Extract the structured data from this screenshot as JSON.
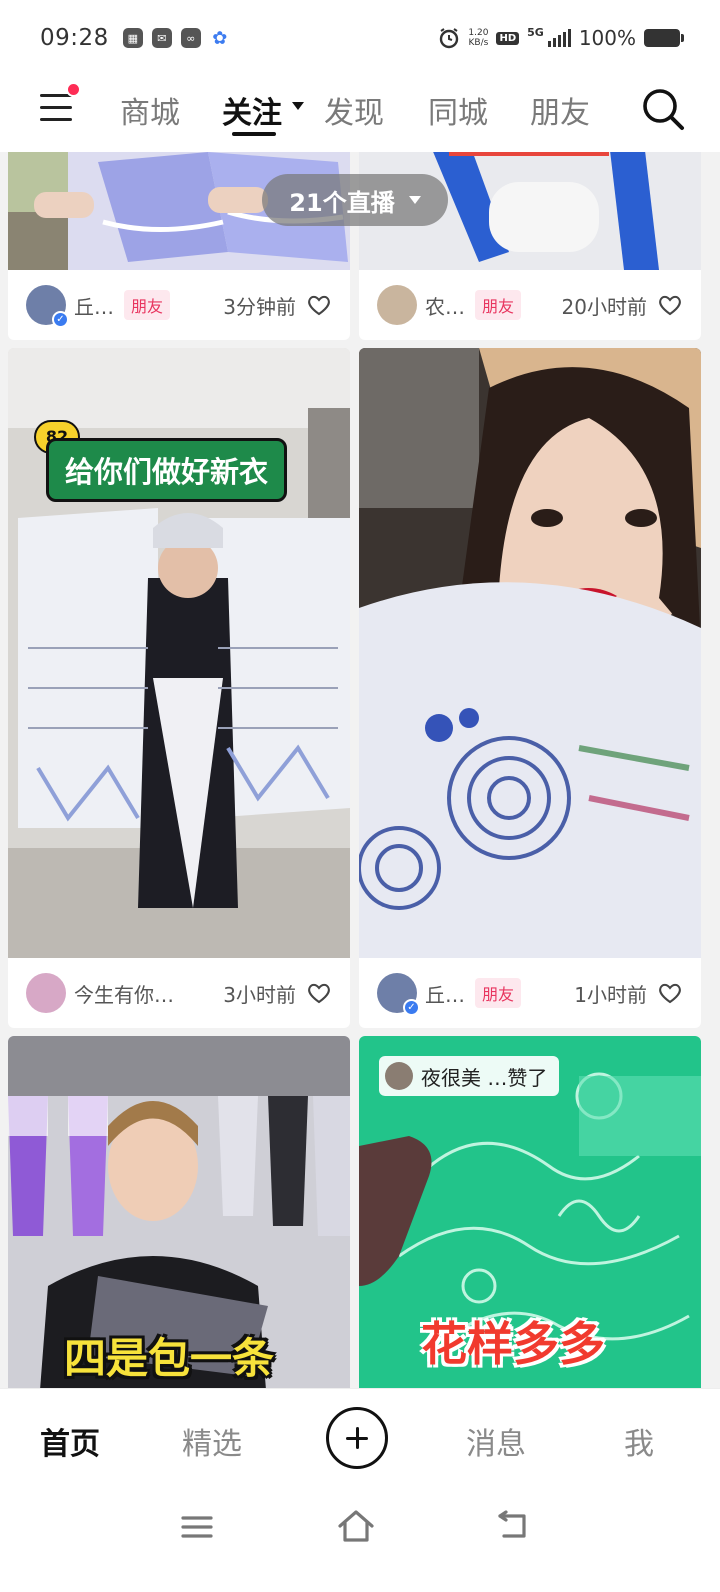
{
  "status_bar": {
    "time": "09:28",
    "net_speed_value": "1.20",
    "net_speed_unit": "KB/s",
    "hd": "HD",
    "network": "5G",
    "battery": "100%"
  },
  "top_nav": {
    "tabs": [
      "商城",
      "关注",
      "发现",
      "同城",
      "朋友"
    ],
    "active_tab": "关注"
  },
  "live_pill": {
    "label": "21个直播"
  },
  "feed": {
    "cards": [
      {
        "author": "丘…",
        "badge": "朋友",
        "time": "3分钟前",
        "verified": true
      },
      {
        "author": "农…",
        "badge": "朋友",
        "time": "20小时前",
        "verified": false
      },
      {
        "caption_icon": "82",
        "caption": "给你们做好新衣",
        "author": "今生有你…",
        "badge": "",
        "time": "3小时前",
        "verified": false
      },
      {
        "author": "丘…",
        "badge": "朋友",
        "time": "1小时前",
        "verified": true
      },
      {
        "caption": "四是包一条"
      },
      {
        "liked_by": "夜很美 …赞了",
        "caption": "花样多多"
      }
    ]
  },
  "tab_bar": {
    "items": [
      "首页",
      "精选",
      "消息",
      "我"
    ],
    "active": "首页"
  },
  "colors": {
    "accent_red": "#fe2c55",
    "friend_badge_text": "#e8355f",
    "friend_badge_bg": "#fde8ee"
  }
}
